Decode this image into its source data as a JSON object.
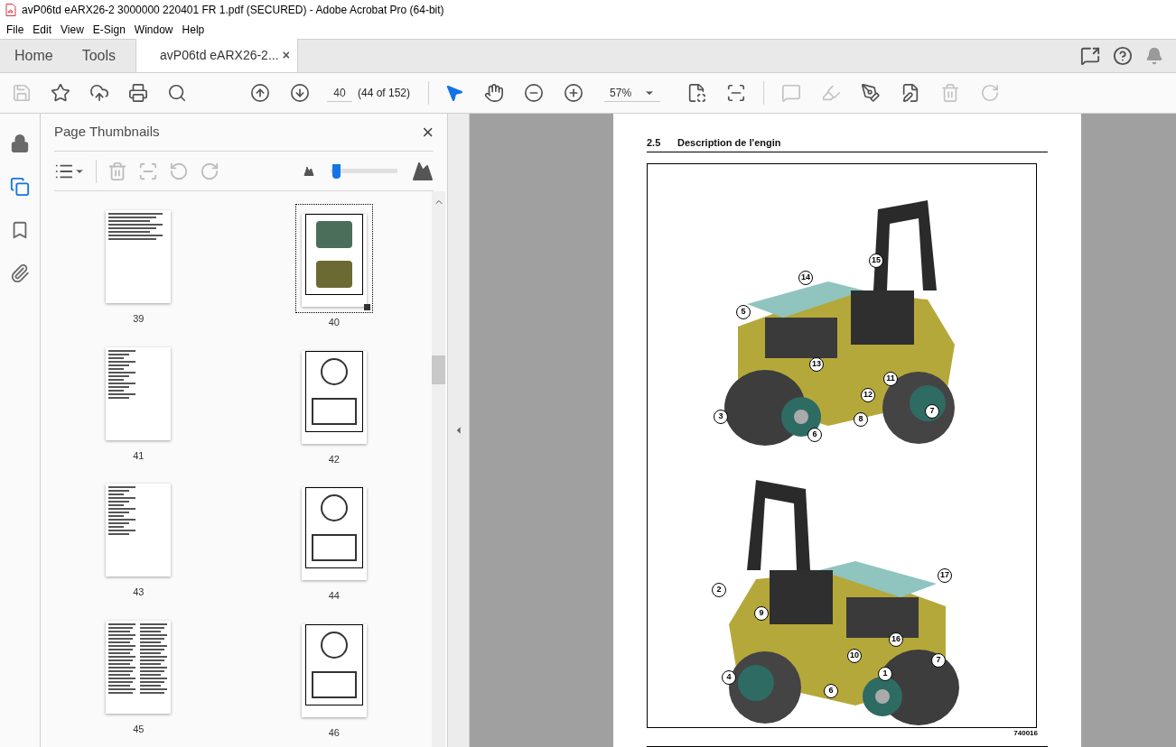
{
  "window": {
    "title": "avP06td eARX26-2 3000000 220401 FR 1.pdf (SECURED) - Adobe Acrobat Pro (64-bit)"
  },
  "menu": [
    "File",
    "Edit",
    "View",
    "E-Sign",
    "Window",
    "Help"
  ],
  "tabs": [
    {
      "label": "Home",
      "selected": false,
      "kind": "nav"
    },
    {
      "label": "Tools",
      "selected": false,
      "kind": "nav"
    },
    {
      "label": "avP06td eARX26-2...",
      "selected": true,
      "kind": "document",
      "close": "×"
    }
  ],
  "toolbar": {
    "left": [
      {
        "kind": "save",
        "disabled": true
      },
      {
        "kind": "star",
        "disabled": false
      },
      {
        "kind": "upload",
        "disabled": false
      },
      {
        "kind": "print",
        "disabled": false
      },
      {
        "kind": "find",
        "disabled": false
      }
    ],
    "nav": [
      {
        "kind": "up",
        "disabled": false
      },
      {
        "kind": "down",
        "disabled": false
      }
    ],
    "page_field": {
      "value": "40"
    },
    "page_count": "(44 of 152)",
    "view": [
      {
        "kind": "select",
        "selected": true
      },
      {
        "kind": "hand",
        "selected": false
      },
      {
        "kind": "zoom-out",
        "selected": false
      },
      {
        "kind": "zoom-in",
        "selected": false
      }
    ],
    "zoom": {
      "value": "57%"
    },
    "right": [
      {
        "kind": "fit",
        "disabled": false
      },
      {
        "kind": "scroll",
        "disabled": false
      },
      {
        "kind": "comment",
        "disabled": true
      },
      {
        "kind": "highlight",
        "disabled": true
      },
      {
        "kind": "sign",
        "disabled": false
      },
      {
        "kind": "edit",
        "disabled": false
      },
      {
        "kind": "delete",
        "disabled": true
      },
      {
        "kind": "redo",
        "disabled": true
      }
    ]
  },
  "rail": [
    {
      "kind": "lock",
      "selected": false
    },
    {
      "kind": "pages",
      "selected": true
    },
    {
      "kind": "bookmark",
      "selected": false
    },
    {
      "kind": "attachment",
      "selected": false
    }
  ],
  "panel": {
    "title": "Page Thumbnails",
    "close": "×",
    "size_slider": {
      "level": 0.08
    },
    "thumbnails": [
      {
        "label": "39",
        "kind": "text",
        "selected": false
      },
      {
        "label": "40",
        "kind": "figure",
        "selected": true
      },
      {
        "label": "41",
        "kind": "list",
        "selected": false
      },
      {
        "label": "42",
        "kind": "diagram",
        "selected": false
      },
      {
        "label": "43",
        "kind": "list",
        "selected": false
      },
      {
        "label": "44",
        "kind": "diagram",
        "selected": false
      },
      {
        "label": "45",
        "kind": "columns",
        "selected": false
      },
      {
        "label": "46",
        "kind": "diagram",
        "selected": false
      }
    ]
  },
  "document": {
    "section_number": "2.5",
    "section_title": "Description de l'engin",
    "figure_id": "740016",
    "callouts": [
      {
        "label": "14"
      },
      {
        "label": "15"
      },
      {
        "label": "5"
      },
      {
        "label": "13"
      },
      {
        "label": "11"
      },
      {
        "label": "12"
      },
      {
        "label": "3"
      },
      {
        "label": "6"
      },
      {
        "label": "8"
      },
      {
        "label": "7"
      },
      {
        "label": "17"
      },
      {
        "label": "2"
      },
      {
        "label": "9"
      },
      {
        "label": "16"
      },
      {
        "label": "10"
      },
      {
        "label": "7"
      },
      {
        "label": "1"
      },
      {
        "label": "4"
      },
      {
        "label": "6"
      }
    ]
  }
}
